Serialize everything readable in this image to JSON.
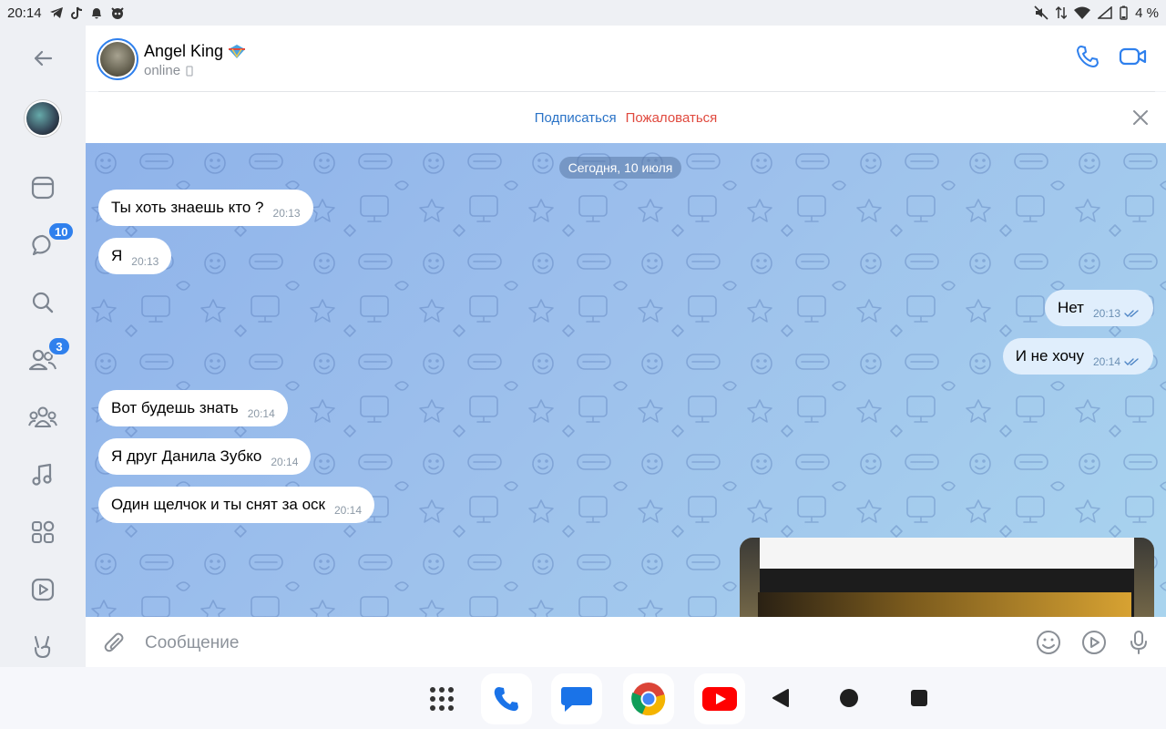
{
  "status_bar": {
    "time": "20:14",
    "battery": "4 %",
    "left_icons": [
      "telegram-icon",
      "tiktok-icon",
      "notification-bell-icon",
      "app-icon"
    ],
    "right_icons": [
      "mute-icon",
      "data-arrows-icon",
      "wifi-icon",
      "signal-icon",
      "battery-icon"
    ]
  },
  "rail": {
    "items": [
      {
        "name": "back",
        "icon": "arrow-left-icon"
      },
      {
        "name": "profile",
        "icon": "avatar"
      },
      {
        "name": "feed",
        "icon": "window-icon"
      },
      {
        "name": "messages",
        "icon": "chat-bubble-icon",
        "badge": "10"
      },
      {
        "name": "search",
        "icon": "search-icon"
      },
      {
        "name": "friends",
        "icon": "friends-icon",
        "badge": "3"
      },
      {
        "name": "communities",
        "icon": "community-icon"
      },
      {
        "name": "music",
        "icon": "music-note-icon"
      },
      {
        "name": "services",
        "icon": "grid-icon"
      },
      {
        "name": "video",
        "icon": "play-box-icon"
      },
      {
        "name": "clips",
        "icon": "peace-hand-icon"
      }
    ]
  },
  "header": {
    "contact_name": "Angel King",
    "contact_status": "online",
    "call_icon": "phone-icon",
    "video_icon": "video-camera-icon"
  },
  "action_bar": {
    "subscribe": "Подписаться",
    "report": "Пожаловаться"
  },
  "chat": {
    "date_label": "Сегодня, 10 июля",
    "messages": [
      {
        "direction": "in",
        "text": "Ты хоть знаешь кто ?",
        "time": "20:13"
      },
      {
        "direction": "in",
        "text": "Я",
        "time": "20:13"
      },
      {
        "direction": "out",
        "text": "Нет",
        "time": "20:13",
        "read": true
      },
      {
        "direction": "out",
        "text": "И не хочу",
        "time": "20:14",
        "read": true
      },
      {
        "direction": "in",
        "text": "Вот будешь знать",
        "time": "20:14"
      },
      {
        "direction": "in",
        "text": "Я друг Данила Зубко",
        "time": "20:14"
      },
      {
        "direction": "in",
        "text": "Один щелчок и ты снят за оск",
        "time": "20:14"
      }
    ]
  },
  "input": {
    "placeholder": "Сообщение",
    "attach_icon": "paperclip-icon",
    "emoji_icon": "smiley-icon",
    "clip_icon": "play-circle-icon",
    "voice_icon": "microphone-icon"
  },
  "navbar": {
    "apps": [
      "app-drawer-icon",
      "phone-app-icon",
      "messages-app-icon",
      "chrome-icon",
      "youtube-icon"
    ],
    "buttons": [
      "back-triangle-icon",
      "home-circle-icon",
      "recents-square-icon"
    ]
  },
  "colors": {
    "accent": "#2f80ed",
    "link": "#2a73c7",
    "danger": "#e0493e",
    "incoming_bubble": "#ffffff",
    "outgoing_bubble": "#e0eefc"
  }
}
